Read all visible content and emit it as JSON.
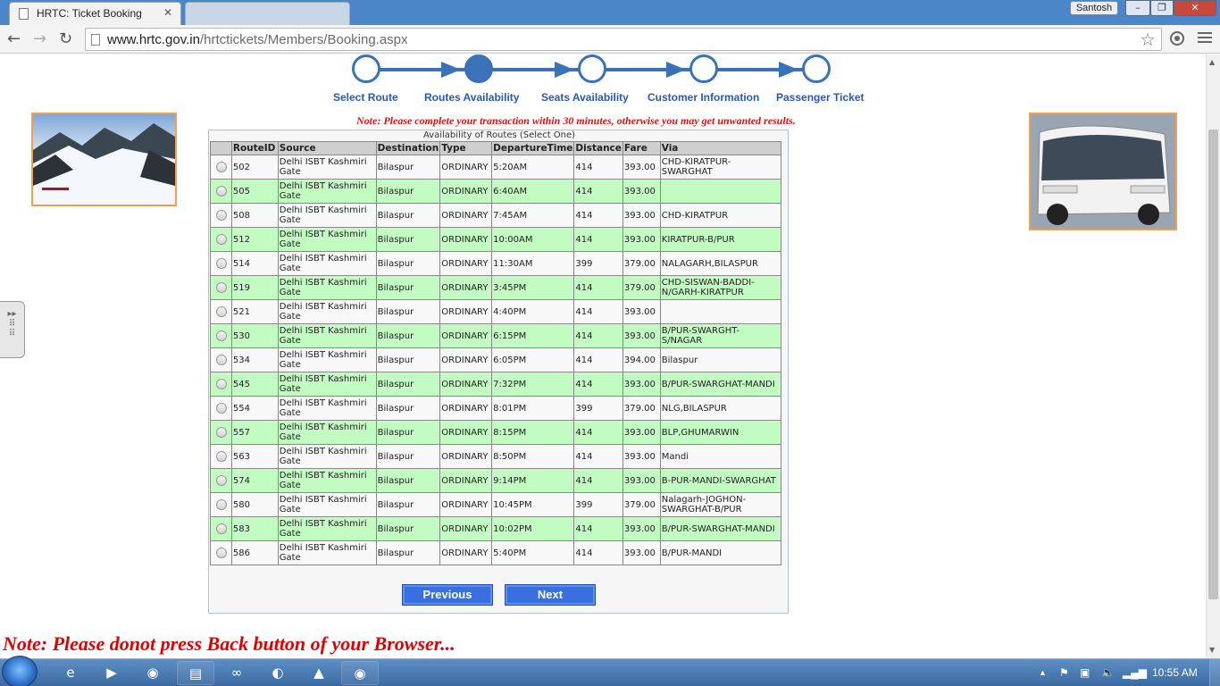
{
  "browser": {
    "tabs": [
      {
        "title": "HRTC: Ticket Booking",
        "active": true
      },
      {
        "title": "",
        "active": false
      }
    ],
    "user": "Santosh",
    "url_host": "www.hrtc.gov.in",
    "url_path": "/hrtctickets/Members/Booking.aspx"
  },
  "steps": [
    {
      "label": "Select Route"
    },
    {
      "label": "Routes Availability"
    },
    {
      "label": "Seats Availability"
    },
    {
      "label": "Customer Information"
    },
    {
      "label": "Passenger Ticket"
    }
  ],
  "note_top": "Note: Please complete your transaction within 30 minutes, otherwise you may get unwanted results.",
  "table": {
    "caption": "Availability of Routes (Select One)",
    "headers": [
      "",
      "RouteID",
      "Source",
      "Destination",
      "Type",
      "DepartureTime",
      "Distance",
      "Fare",
      "Via"
    ],
    "rows": [
      {
        "id": "502",
        "source": "Delhi ISBT Kashmiri Gate",
        "destination": "Bilaspur",
        "type": "ORDINARY",
        "departure": "5:20AM",
        "distance": "414",
        "fare": "393.00",
        "via": "CHD-KIRATPUR-SWARGHAT"
      },
      {
        "id": "505",
        "source": "Delhi ISBT Kashmiri Gate",
        "destination": "Bilaspur",
        "type": "ORDINARY",
        "departure": "6:40AM",
        "distance": "414",
        "fare": "393.00",
        "via": ""
      },
      {
        "id": "508",
        "source": "Delhi ISBT Kashmiri Gate",
        "destination": "Bilaspur",
        "type": "ORDINARY",
        "departure": "7:45AM",
        "distance": "414",
        "fare": "393.00",
        "via": "CHD-KIRATPUR"
      },
      {
        "id": "512",
        "source": "Delhi ISBT Kashmiri Gate",
        "destination": "Bilaspur",
        "type": "ORDINARY",
        "departure": "10:00AM",
        "distance": "414",
        "fare": "393.00",
        "via": "KIRATPUR-B/PUR"
      },
      {
        "id": "514",
        "source": "Delhi ISBT Kashmiri Gate",
        "destination": "Bilaspur",
        "type": "ORDINARY",
        "departure": "11:30AM",
        "distance": "399",
        "fare": "379.00",
        "via": "NALAGARH,BILASPUR"
      },
      {
        "id": "519",
        "source": "Delhi ISBT Kashmiri Gate",
        "destination": "Bilaspur",
        "type": "ORDINARY",
        "departure": "3:45PM",
        "distance": "414",
        "fare": "379.00",
        "via": "CHD-SISWAN-BADDI-N/GARH-KIRATPUR"
      },
      {
        "id": "521",
        "source": "Delhi ISBT Kashmiri Gate",
        "destination": "Bilaspur",
        "type": "ORDINARY",
        "departure": "4:40PM",
        "distance": "414",
        "fare": "393.00",
        "via": ""
      },
      {
        "id": "530",
        "source": "Delhi ISBT Kashmiri Gate",
        "destination": "Bilaspur",
        "type": "ORDINARY",
        "departure": "6:15PM",
        "distance": "414",
        "fare": "393.00",
        "via": "B/PUR-SWARGHT-S/NAGAR"
      },
      {
        "id": "534",
        "source": "Delhi ISBT Kashmiri Gate",
        "destination": "Bilaspur",
        "type": "ORDINARY",
        "departure": "6:05PM",
        "distance": "414",
        "fare": "394.00",
        "via": "Bilaspur"
      },
      {
        "id": "545",
        "source": "Delhi ISBT Kashmiri Gate",
        "destination": "Bilaspur",
        "type": "ORDINARY",
        "departure": "7:32PM",
        "distance": "414",
        "fare": "393.00",
        "via": "B/PUR-SWARGHAT-MANDI"
      },
      {
        "id": "554",
        "source": "Delhi ISBT Kashmiri Gate",
        "destination": "Bilaspur",
        "type": "ORDINARY",
        "departure": "8:01PM",
        "distance": "399",
        "fare": "379.00",
        "via": "NLG,BILASPUR"
      },
      {
        "id": "557",
        "source": "Delhi ISBT Kashmiri Gate",
        "destination": "Bilaspur",
        "type": "ORDINARY",
        "departure": "8:15PM",
        "distance": "414",
        "fare": "393.00",
        "via": "BLP,GHUMARWIN"
      },
      {
        "id": "563",
        "source": "Delhi ISBT Kashmiri Gate",
        "destination": "Bilaspur",
        "type": "ORDINARY",
        "departure": "8:50PM",
        "distance": "414",
        "fare": "393.00",
        "via": "Mandi"
      },
      {
        "id": "574",
        "source": "Delhi ISBT Kashmiri Gate",
        "destination": "Bilaspur",
        "type": "ORDINARY",
        "departure": "9:14PM",
        "distance": "414",
        "fare": "393.00",
        "via": "B-PUR-MANDI-SWARGHAT"
      },
      {
        "id": "580",
        "source": "Delhi ISBT Kashmiri Gate",
        "destination": "Bilaspur",
        "type": "ORDINARY",
        "departure": "10:45PM",
        "distance": "399",
        "fare": "379.00",
        "via": "Nalagarh-JOGHON-SWARGHAT-B/PUR"
      },
      {
        "id": "583",
        "source": "Delhi ISBT Kashmiri Gate",
        "destination": "Bilaspur",
        "type": "ORDINARY",
        "departure": "10:02PM",
        "distance": "414",
        "fare": "393.00",
        "via": "B/PUR-SWARGHAT-MANDI"
      },
      {
        "id": "586",
        "source": "Delhi ISBT Kashmiri Gate",
        "destination": "Bilaspur",
        "type": "ORDINARY",
        "departure": "5:40PM",
        "distance": "414",
        "fare": "393.00",
        "via": "B/PUR-MANDI"
      }
    ]
  },
  "buttons": {
    "previous": "Previous",
    "next": "Next"
  },
  "note_bottom": "Note: Please donot press Back button of your Browser...",
  "taskbar": {
    "clock": "10:55 AM"
  },
  "colors": {
    "accent": "#3a72b8",
    "row_alt": "#c2fcc2",
    "warning": "#e00000",
    "button": "#3a6fe0"
  }
}
